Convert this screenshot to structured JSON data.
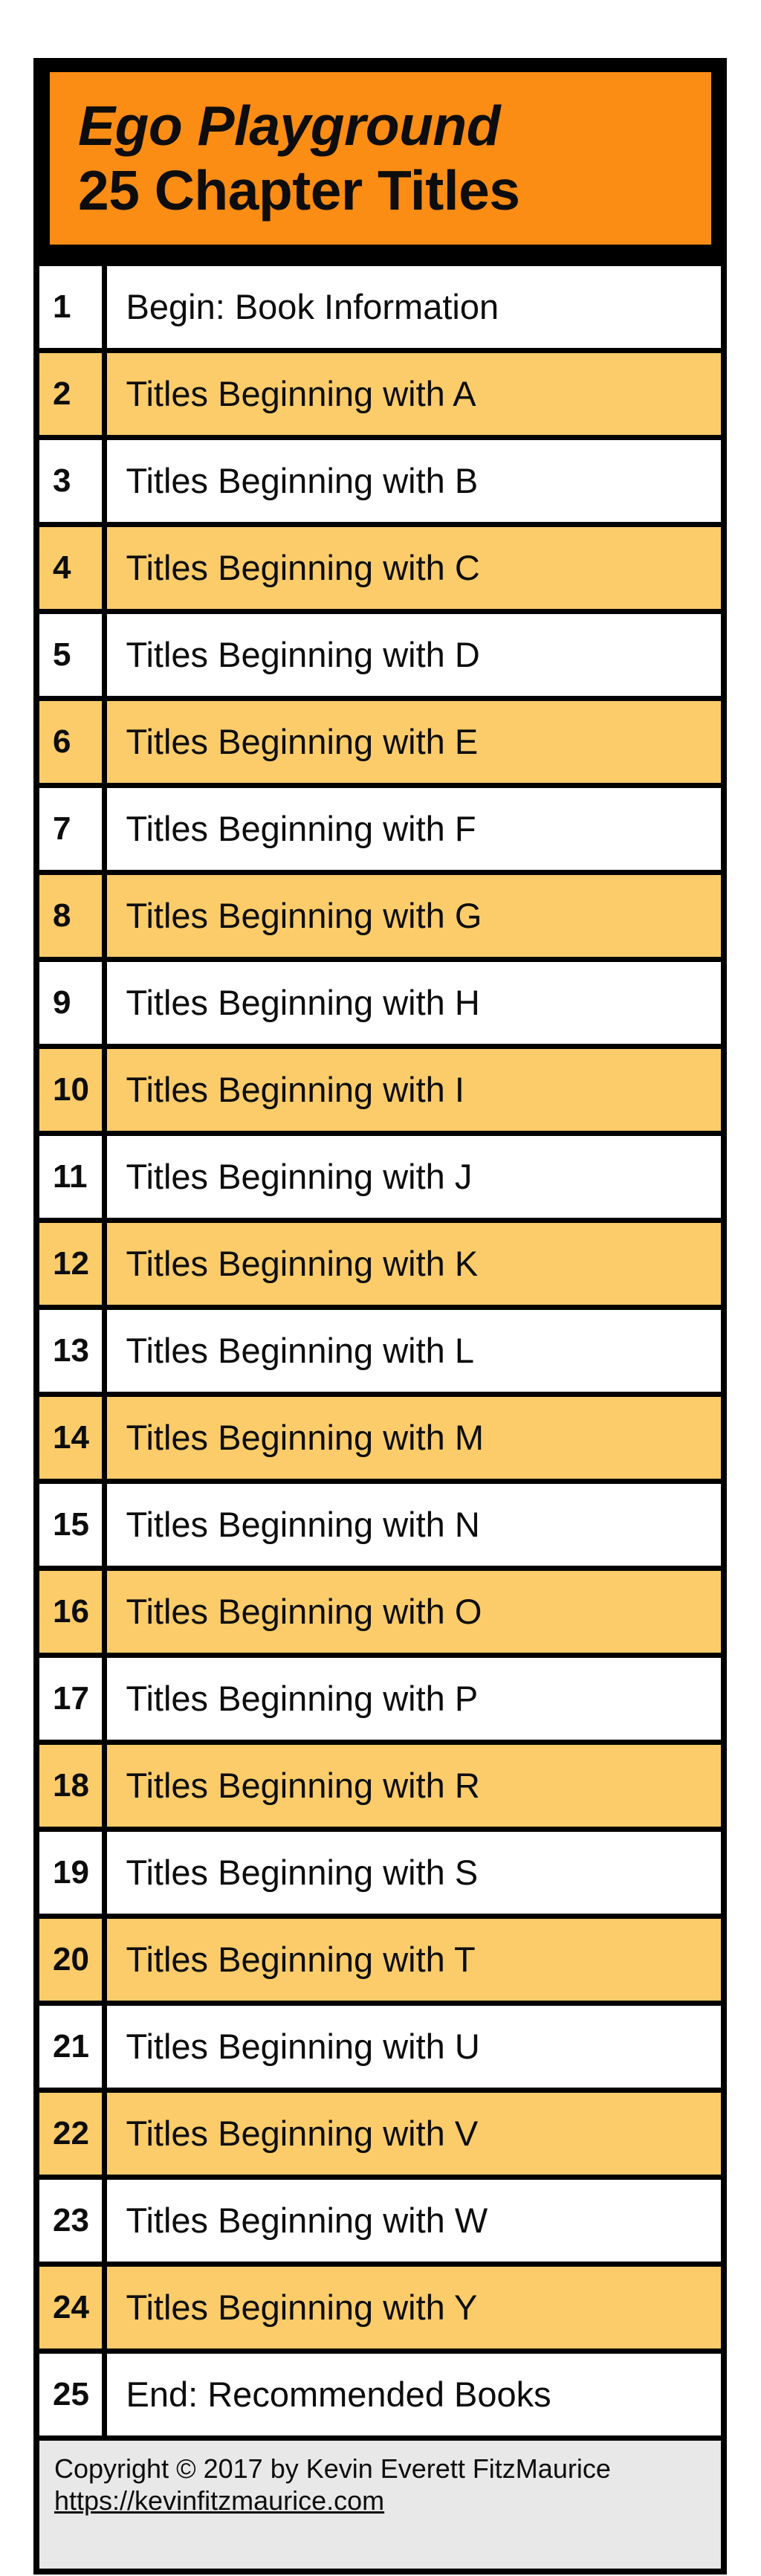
{
  "banner": {
    "title_line_1": "Ego Playground",
    "title_line_2": "25 Chapter Titles",
    "background_color": "#FB8C14",
    "border_color": "#000000",
    "text_color": "#0D0D0D"
  },
  "colors": {
    "shaded_row": "#FCCC6A",
    "plain_row": "#FFFFFF",
    "grid_line": "#000000",
    "footer_background": "#E8E8E8"
  },
  "table": {
    "row_count": 25,
    "rows": [
      {
        "number": "1",
        "title": "Begin: Book Information",
        "shaded": false
      },
      {
        "number": "2",
        "title": "Titles Beginning with A",
        "shaded": true
      },
      {
        "number": "3",
        "title": "Titles Beginning with B",
        "shaded": false
      },
      {
        "number": "4",
        "title": "Titles Beginning with C",
        "shaded": true
      },
      {
        "number": "5",
        "title": "Titles Beginning with D",
        "shaded": false
      },
      {
        "number": "6",
        "title": "Titles Beginning with E",
        "shaded": true
      },
      {
        "number": "7",
        "title": "Titles Beginning with F",
        "shaded": false
      },
      {
        "number": "8",
        "title": "Titles Beginning with G",
        "shaded": true
      },
      {
        "number": "9",
        "title": "Titles Beginning with H",
        "shaded": false
      },
      {
        "number": "10",
        "title": "Titles Beginning with I",
        "shaded": true
      },
      {
        "number": "11",
        "title": "Titles Beginning with J",
        "shaded": false
      },
      {
        "number": "12",
        "title": "Titles Beginning with K",
        "shaded": true
      },
      {
        "number": "13",
        "title": "Titles Beginning with L",
        "shaded": false
      },
      {
        "number": "14",
        "title": "Titles Beginning with M",
        "shaded": true
      },
      {
        "number": "15",
        "title": "Titles Beginning with N",
        "shaded": false
      },
      {
        "number": "16",
        "title": "Titles Beginning with O",
        "shaded": true
      },
      {
        "number": "17",
        "title": "Titles Beginning with P",
        "shaded": false
      },
      {
        "number": "18",
        "title": "Titles Beginning with R",
        "shaded": true
      },
      {
        "number": "19",
        "title": "Titles Beginning with S",
        "shaded": false
      },
      {
        "number": "20",
        "title": "Titles Beginning with T",
        "shaded": true
      },
      {
        "number": "21",
        "title": "Titles Beginning with U",
        "shaded": false
      },
      {
        "number": "22",
        "title": "Titles Beginning with V",
        "shaded": true
      },
      {
        "number": "23",
        "title": "Titles Beginning with W",
        "shaded": false
      },
      {
        "number": "24",
        "title": "Titles Beginning with Y",
        "shaded": true
      },
      {
        "number": "25",
        "title": "End: Recommended Books",
        "shaded": false
      }
    ]
  },
  "footer": {
    "copyright": "Copyright © 2017 by Kevin Everett FitzMaurice",
    "url": "https://kevinfitzmaurice.com"
  }
}
